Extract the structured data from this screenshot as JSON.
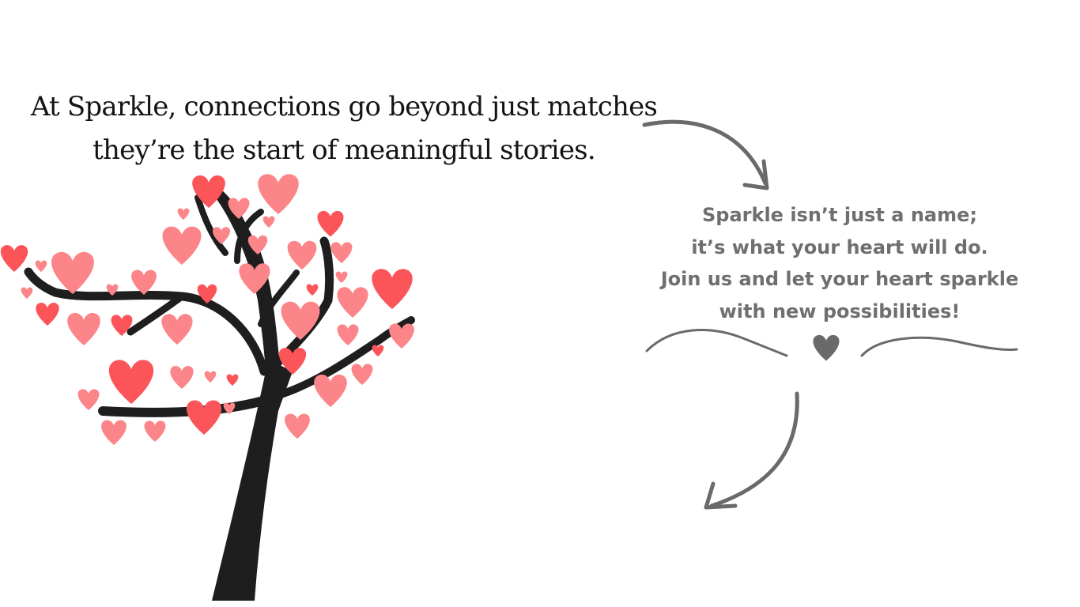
{
  "headline": {
    "line1": "At Sparkle, connections go beyond just matches",
    "line2": "they’re the start of meaningful stories."
  },
  "tagline": {
    "line1": "Sparkle isn’t just a name;",
    "line2": "it’s what your heart will do.",
    "line3": "Join us and let your heart sparkle",
    "line4": "with new possibilities!"
  },
  "colors": {
    "text_dark": "#141414",
    "text_grey": "#6f6f6f",
    "heart_red": "#fb5459",
    "heart_pink": "#fb8589",
    "trunk": "#1e1e1e",
    "arrow": "#6a6a6a"
  }
}
